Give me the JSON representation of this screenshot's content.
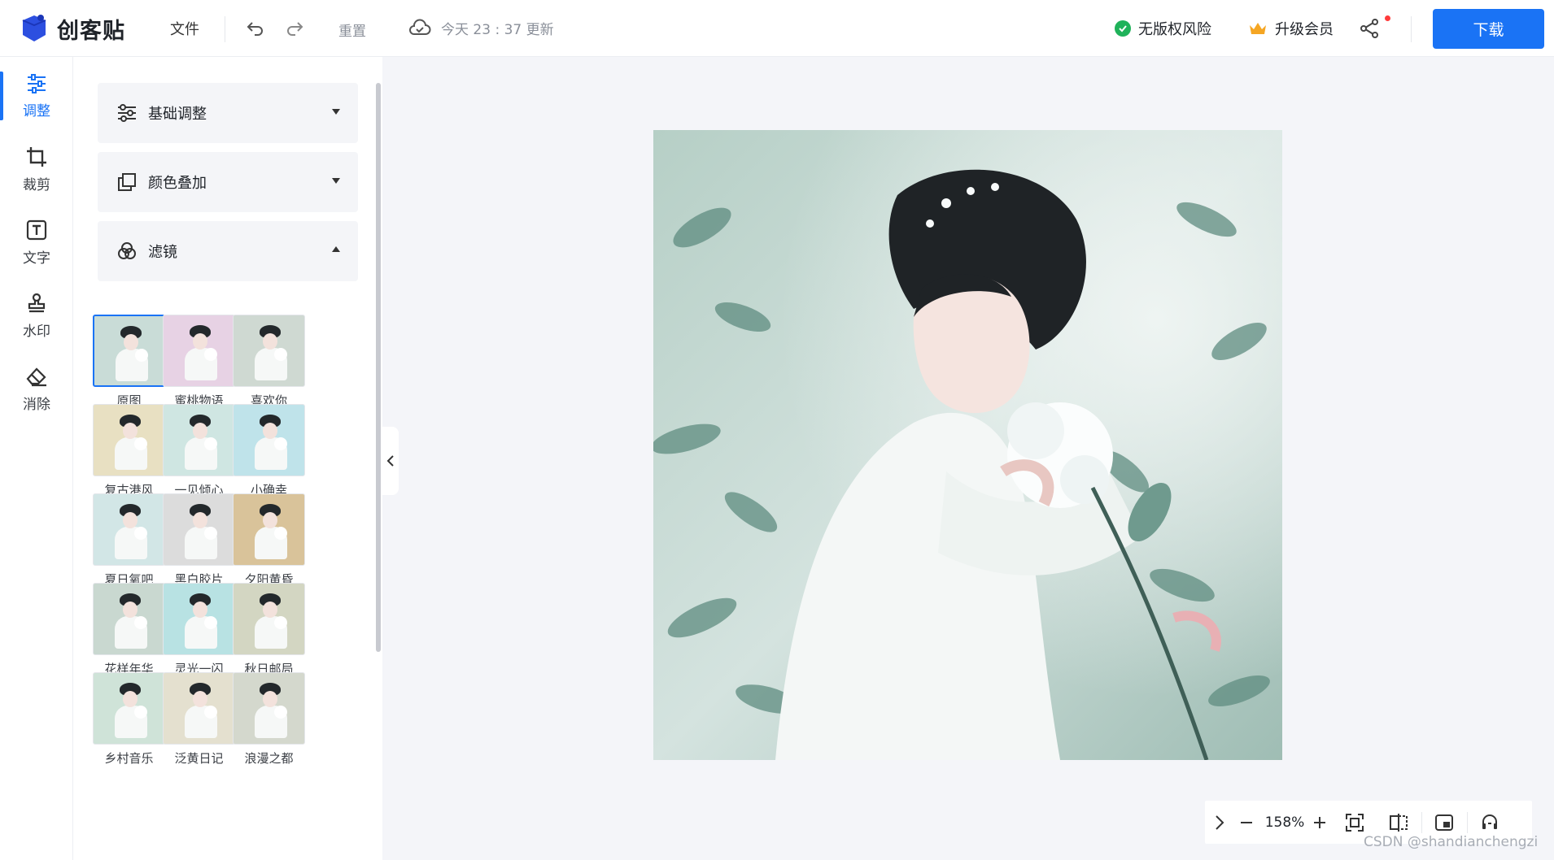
{
  "header": {
    "logo_text": "创客贴",
    "file_menu": "文件",
    "reset_label": "重置",
    "save_status": "今天 23 : 37 更新",
    "copyright_label": "无版权风险",
    "vip_label": "升级会员",
    "download_label": "下载"
  },
  "rail": {
    "items": [
      {
        "label": "调整",
        "icon": "sliders-icon",
        "active": true
      },
      {
        "label": "裁剪",
        "icon": "crop-icon",
        "active": false
      },
      {
        "label": "文字",
        "icon": "text-icon",
        "active": false
      },
      {
        "label": "水印",
        "icon": "stamp-icon",
        "active": false
      },
      {
        "label": "消除",
        "icon": "eraser-icon",
        "active": false
      }
    ]
  },
  "panel": {
    "sections": [
      {
        "label": "基础调整",
        "icon": "sliders-icon",
        "expanded": false
      },
      {
        "label": "颜色叠加",
        "icon": "layers-icon",
        "expanded": false
      },
      {
        "label": "滤镜",
        "icon": "filter-icon",
        "expanded": true
      }
    ],
    "filters": [
      {
        "name": "原图",
        "tint": "#c9dcd7",
        "selected": true
      },
      {
        "name": "蜜桃物语",
        "tint": "#e7d2e4",
        "selected": false
      },
      {
        "name": "喜欢你",
        "tint": "#cfd9d2",
        "selected": false
      },
      {
        "name": "复古港风",
        "tint": "#e8e0c2",
        "selected": false
      },
      {
        "name": "一见倾心",
        "tint": "#cfe6e2",
        "selected": false
      },
      {
        "name": "小确幸",
        "tint": "#bfe3ea",
        "selected": false
      },
      {
        "name": "夏日氧吧",
        "tint": "#d2e6e6",
        "selected": false
      },
      {
        "name": "黑白胶片",
        "tint": "#dcdcdc",
        "selected": false
      },
      {
        "name": "夕阳黄昏",
        "tint": "#d9c39a",
        "selected": false
      },
      {
        "name": "花样年华",
        "tint": "#c9d8d0",
        "selected": false
      },
      {
        "name": "灵光一闪",
        "tint": "#b8e2e3",
        "selected": false
      },
      {
        "name": "秋日邮局",
        "tint": "#d3d6c2",
        "selected": false
      },
      {
        "name": "乡村音乐",
        "tint": "#cfe3d8",
        "selected": false
      },
      {
        "name": "泛黄日记",
        "tint": "#e4e0cf",
        "selected": false
      },
      {
        "name": "浪漫之都",
        "tint": "#d4d8cd",
        "selected": false
      }
    ]
  },
  "zoom": {
    "value": "158%"
  },
  "watermark": "CSDN @shandianchengzi",
  "colors": {
    "accent": "#1a73f5",
    "ok": "#1fb25a",
    "vip": "#f5a623"
  }
}
